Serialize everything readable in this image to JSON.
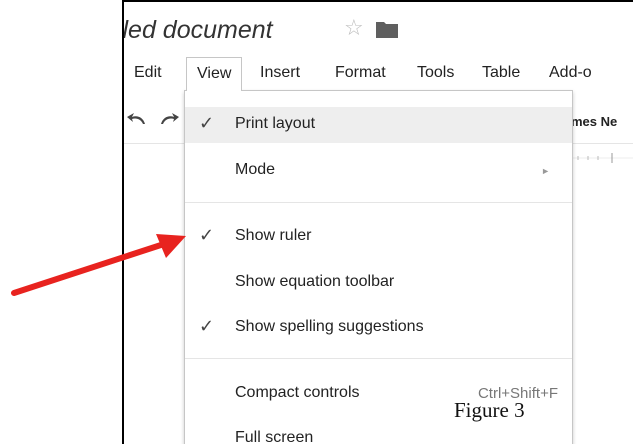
{
  "document": {
    "title": "itled document",
    "star_icon": "star-outline-icon",
    "folder_icon": "folder-icon"
  },
  "menubar": {
    "items": [
      {
        "label": "Edit"
      },
      {
        "label": "View",
        "active": true
      },
      {
        "label": "Insert"
      },
      {
        "label": "Format"
      },
      {
        "label": "Tools"
      },
      {
        "label": "Table"
      },
      {
        "label": "Add-o"
      }
    ]
  },
  "toolbar": {
    "undo_icon": "undo-icon",
    "redo_icon": "redo-icon",
    "font_name": "mes Ne"
  },
  "view_menu": {
    "items": [
      {
        "label": "Print layout",
        "checked": true,
        "highlighted": true
      },
      {
        "label": "Mode",
        "submenu": true
      },
      {
        "label": "Show ruler",
        "checked": true
      },
      {
        "label": "Show equation toolbar",
        "checked": false
      },
      {
        "label": "Show spelling suggestions",
        "checked": true
      },
      {
        "label": "Compact controls",
        "shortcut": "Ctrl+Shift+F"
      },
      {
        "label": "Full screen"
      }
    ],
    "check_glyph": "✓",
    "submenu_glyph": "►"
  },
  "annotation": {
    "caption": "Figure 3",
    "arrow_color": "#e8231f"
  }
}
